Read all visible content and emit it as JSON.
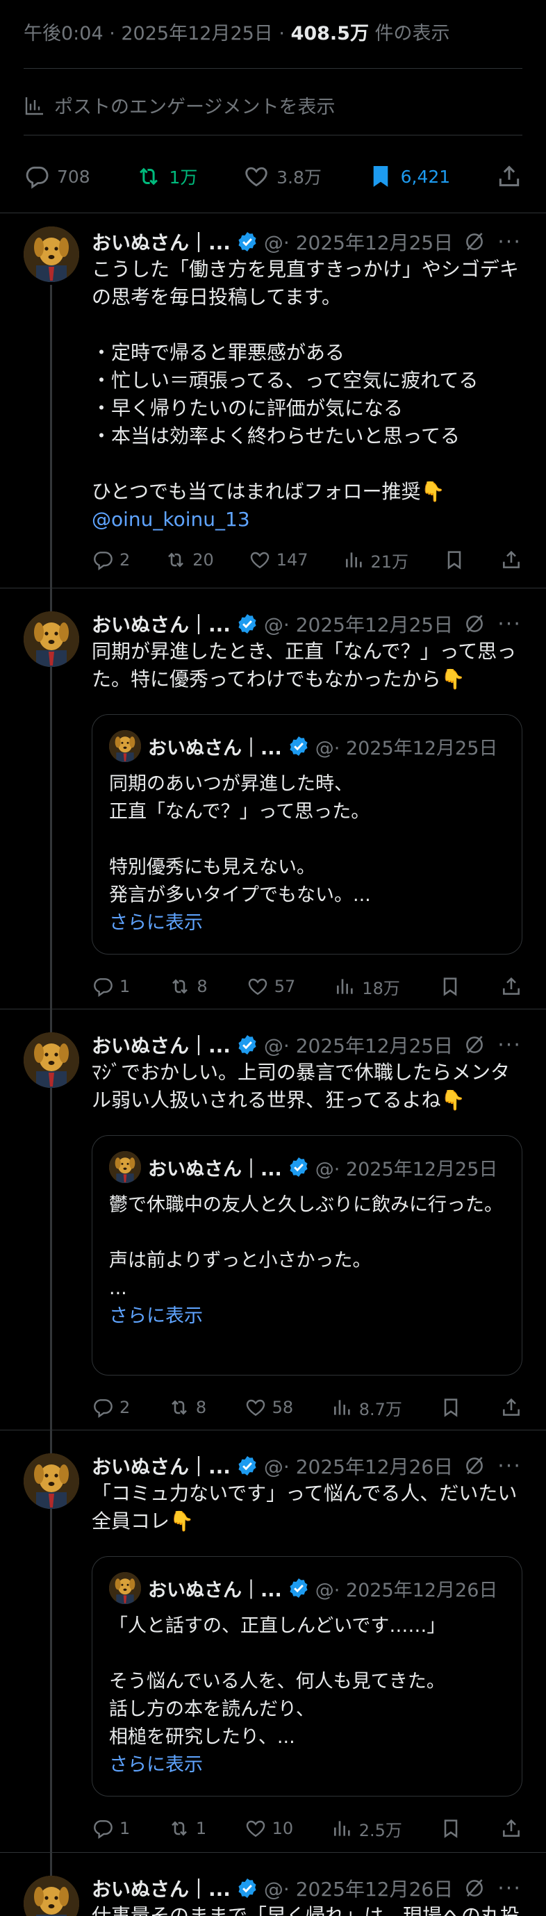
{
  "header": {
    "time_date": "午後0:04 · 2025年12月25日 · ",
    "views_count": "408.5万",
    "views_label": " 件の表示",
    "engagement_label": "ポストのエンゲージメントを表示"
  },
  "main_actions": {
    "replies": "708",
    "reposts": "1万",
    "likes": "3.8万",
    "bookmarks": "6,421"
  },
  "colors": {
    "repost_active": "#00ba7c",
    "bookmark_active": "#1d9bf0",
    "link": "#5fa4ff",
    "muted": "#71767b",
    "verified": "#1d9bf0"
  },
  "posts": [
    {
      "name": "おいぬさん｜...",
      "date": "@· 2025年12月25日",
      "text": "こうした「働き方を見直すきっかけ」やシゴデキの思考を毎日投稿してます。\n\n・定時で帰ると罪悪感がある\n・忙しい＝頑張ってる、って空気に疲れてる\n・早く帰りたいのに評価が気になる\n・本当は効率よく終わらせたいと思ってる\n\nひとつでも当てはまればフォロー推奨👇",
      "mention": "@oinu_koinu_13",
      "replies": "2",
      "reposts": "20",
      "likes": "147",
      "views": "21万"
    },
    {
      "name": "おいぬさん｜...",
      "date": "@· 2025年12月25日",
      "text": "同期が昇進したとき、正直「なんで？」って思った。特に優秀ってわけでもなかったから👇",
      "quote": {
        "name": "おいぬさん｜...",
        "date": "@· 2025年12月25日",
        "text": "同期のあいつが昇進した時、\n正直「なんで？」って思った。\n\n特別優秀にも見えない。\n発言が多いタイプでもない。...",
        "show_more": "さらに表示"
      },
      "replies": "1",
      "reposts": "8",
      "likes": "57",
      "views": "18万"
    },
    {
      "name": "おいぬさん｜...",
      "date": "@· 2025年12月25日",
      "text": "ﾏｼﾞでおかしい。上司の暴言で休職したらメンタル弱い人扱いされる世界、狂ってるよね👇",
      "quote": {
        "name": "おいぬさん｜...",
        "date": "@· 2025年12月25日",
        "text": "鬱で休職中の友人と久しぶりに飲みに行った。\n\n声は前よりずっと小さかった。\n...",
        "show_more": "さらに表示"
      },
      "replies": "2",
      "reposts": "8",
      "likes": "58",
      "views": "8.7万"
    },
    {
      "name": "おいぬさん｜...",
      "date": "@· 2025年12月26日",
      "text": "「コミュ力ないです」って悩んでる人、だいたい全員コレ👇",
      "quote": {
        "name": "おいぬさん｜...",
        "date": "@· 2025年12月26日",
        "text": "「人と話すの、正直しんどいです……」\n\nそう悩んでいる人を、何人も見てきた。\n話し方の本を読んだり、\n相槌を研究したり、...",
        "show_more": "さらに表示"
      },
      "replies": "1",
      "reposts": "1",
      "likes": "10",
      "views": "2.5万"
    },
    {
      "name": "おいぬさん｜...",
      "date": "@· 2025年12月26日",
      "text": "仕事量そのままで「早く帰れ」は、現場への丸投"
    }
  ]
}
